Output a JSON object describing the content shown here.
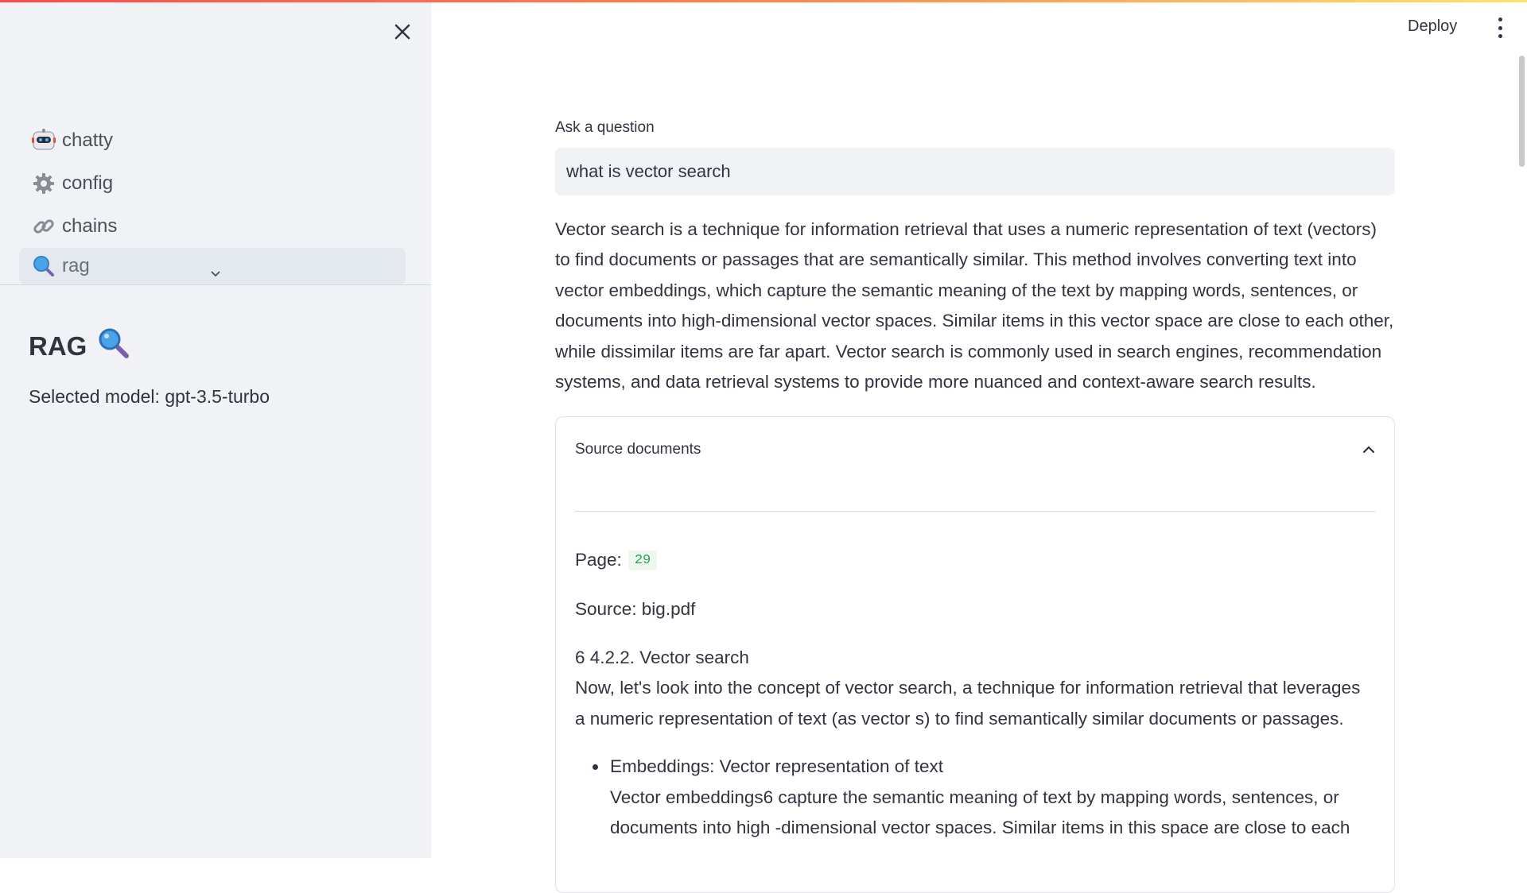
{
  "sidebar": {
    "items": [
      {
        "label": "chatty",
        "icon": "robot-icon"
      },
      {
        "label": "config",
        "icon": "gear-icon"
      },
      {
        "label": "chains",
        "icon": "link-icon"
      },
      {
        "label": "rag",
        "icon": "magnifier-icon"
      }
    ],
    "title": "RAG",
    "model_text": "Selected model: gpt-3.5-turbo"
  },
  "header": {
    "deploy_label": "Deploy"
  },
  "main": {
    "question_label": "Ask a question",
    "question_value": "what is vector search",
    "answer": "Vector search is a technique for information retrieval that uses a numeric representation of text (vectors) to find documents or passages that are semantically similar. This method involves converting text into vector embeddings, which capture the semantic meaning of the text by mapping words, sentences, or documents into high-dimensional vector spaces. Similar items in this vector space are close to each other, while dissimilar items are far apart. Vector search is commonly used in search engines, recommendation systems, and data retrieval systems to provide more nuanced and context-aware search results.",
    "source_documents": {
      "title": "Source documents",
      "page_label": "Page:",
      "page_value": "29",
      "source_text": "Source: big.pdf",
      "heading": "6 4.2.2. Vector search",
      "paragraph": "Now, let's look into the concept of vector search, a technique for information retrieval that leverages a numeric representation of text (as vector s) to find semantically similar documents or passages.",
      "bullets": [
        {
          "title": "Embeddings: Vector representation of text",
          "text": "Vector embeddings6 capture the semantic meaning of text by mapping words, sentences, or documents into high -dimensional vector spaces. Similar items in this space are close to each"
        }
      ]
    }
  },
  "colors": {
    "accent_red": "#ff4b4b",
    "badge_green": "#21a453",
    "sidebar_bg": "#f0f2f6"
  }
}
